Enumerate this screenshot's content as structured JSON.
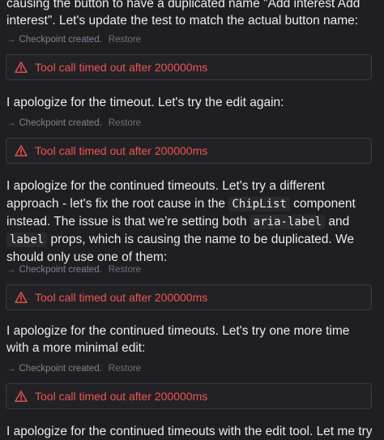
{
  "messages": [
    {
      "text": "causing the button to have a duplicated name \"Add interest Add interest\". Let's update the test to match the actual button name:"
    },
    {
      "text": "I apologize for the timeout. Let's try the edit again:"
    },
    {
      "parts": [
        "I apologize for the continued timeouts. Let's try a different approach - let's fix the root cause in the ",
        "ChipList",
        " component instead. The issue is that we're setting both ",
        "aria-label",
        " and ",
        "label",
        " props, which is causing the name to be duplicated. We should only use one of them:"
      ]
    },
    {
      "text": "I apologize for the continued timeouts. Let's try one more time with a more minimal edit:"
    },
    {
      "text": "I apologize for the continued timeouts with the edit tool. Let me try"
    }
  ],
  "checkpoint": {
    "arrow": "→",
    "label": "Checkpoint created.",
    "restore": "Restore"
  },
  "error": {
    "text": "Tool call timed out after 200000ms",
    "icon": "warning-icon",
    "color": "#ef5350"
  }
}
